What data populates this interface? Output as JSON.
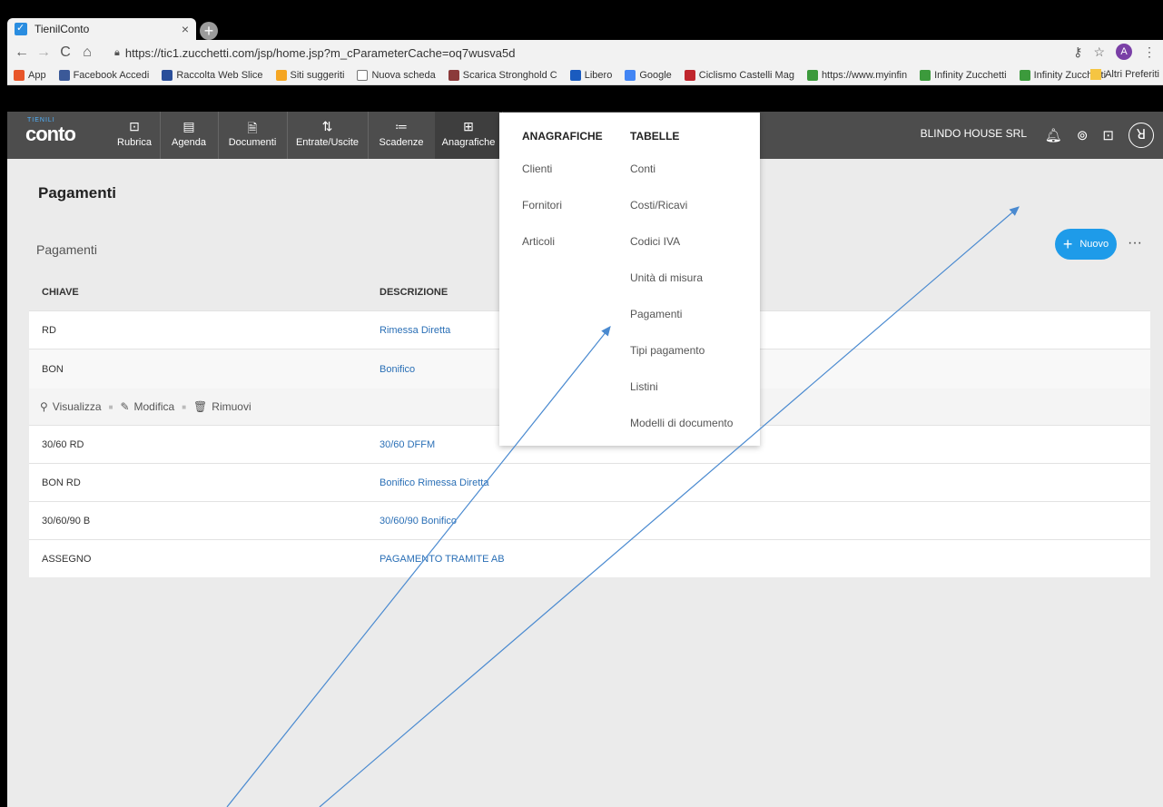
{
  "browser": {
    "tab_title": "TienilConto",
    "tab_close": "×",
    "new_tab": "+",
    "url": "https://tic1.zucchetti.com/jsp/home.jsp?m_cParameterCache=oq7wusva5d",
    "profile_initial": "A",
    "bookmarks": [
      {
        "label": "App",
        "icon": "apps-icon",
        "color": "#e8562a"
      },
      {
        "label": "Facebook Accedi",
        "icon": "facebook-icon",
        "color": "#3b5998"
      },
      {
        "label": "Raccolta Web Slice",
        "icon": "webslice-icon",
        "color": "#2b4f9a"
      },
      {
        "label": "Siti suggeriti",
        "icon": "suggested-sites-icon",
        "color": "#f5a623"
      },
      {
        "label": "Nuova scheda",
        "icon": "page-icon",
        "color": "#ffffff"
      },
      {
        "label": "Scarica Stronghold C",
        "icon": "stronghold-icon",
        "color": "#8b3a3a"
      },
      {
        "label": "Libero",
        "icon": "libero-icon",
        "color": "#1a5bbf"
      },
      {
        "label": "Google",
        "icon": "google-icon",
        "color": "#4285f4"
      },
      {
        "label": "Ciclismo Castelli Mag",
        "icon": "castelli-icon",
        "color": "#c0262d"
      },
      {
        "label": "https://www.myinfin",
        "icon": "infinity-icon",
        "color": "#3c9a3c"
      },
      {
        "label": "Infinity Zucchetti",
        "icon": "infinity-icon",
        "color": "#3c9a3c"
      },
      {
        "label": "Infinity Zucchetti",
        "icon": "infinity-icon",
        "color": "#3c9a3c"
      }
    ],
    "other_bookmarks": "Altri Preferiti"
  },
  "app": {
    "logo_sup": "TIENILI",
    "logo": "conto",
    "nav": [
      {
        "label": "Rubrica",
        "icon": "⊡"
      },
      {
        "label": "Agenda",
        "icon": "▤"
      },
      {
        "label": "Documenti",
        "icon": "🗎"
      },
      {
        "label": "Entrate/Uscite",
        "icon": "⇅"
      },
      {
        "label": "Scadenze",
        "icon": "≔"
      },
      {
        "label": "Anagrafiche",
        "icon": "⊞"
      }
    ],
    "company": "BLINDO HOUSE SRL",
    "header_icons": {
      "bell": "♫",
      "support": "⊚",
      "feedback": "⊡",
      "user": "ꓤ"
    }
  },
  "page": {
    "title": "Pagamenti",
    "list_title": "Pagamenti",
    "new_button": "Nuovo",
    "new_plus": "+",
    "more": "···",
    "columns": [
      "CHIAVE",
      "DESCRIZIONE"
    ],
    "rows": [
      {
        "key": "RD",
        "desc": "Rimessa Diretta"
      },
      {
        "key": "BON",
        "desc": "Bonifico"
      },
      {
        "key": "30/60 RD",
        "desc": "30/60 DFFM"
      },
      {
        "key": "BON RD",
        "desc": "Bonifico Rimessa Diretta"
      },
      {
        "key": "30/60/90 B",
        "desc": "30/60/90 Bonifico"
      },
      {
        "key": "ASSEGNO",
        "desc": "PAGAMENTO TRAMITE AB"
      }
    ],
    "row_actions": {
      "view": "Visualizza",
      "edit": "Modifica",
      "remove": "Rimuovi",
      "sep": "■"
    }
  },
  "dropdown": {
    "col1_header": "ANAGRAFICHE",
    "col1_items": [
      "Clienti",
      "Fornitori",
      "Articoli"
    ],
    "col2_header": "TABELLE",
    "col2_items": [
      "Conti",
      "Costi/Ricavi",
      "Codici IVA",
      "Unità di misura",
      "Pagamenti",
      "Tipi pagamento",
      "Listini",
      "Modelli di documento"
    ]
  },
  "colors": {
    "accent": "#1e9be9",
    "header_bg": "#4d4d4d",
    "link": "#2a6fb6",
    "annotation_arrow": "#4a8ad0"
  }
}
